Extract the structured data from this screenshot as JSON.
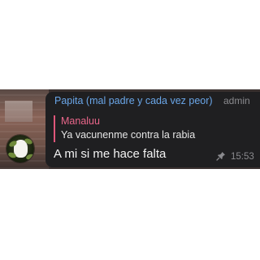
{
  "message": {
    "sender": "Papita (mal padre y cada vez peor)",
    "badge": "admin",
    "reply": {
      "name": "Manaluu",
      "text": "Ya vacunenme contra la rabia"
    },
    "text": "A mi si me hace falta",
    "time": "15:53",
    "status_icon": "pin-icon"
  },
  "colors": {
    "sender": "#6aa6e8",
    "reply_accent": "#e0567a",
    "bubble": "#1f1f21",
    "text": "#f2f2f2",
    "meta": "#8a8a8e"
  }
}
